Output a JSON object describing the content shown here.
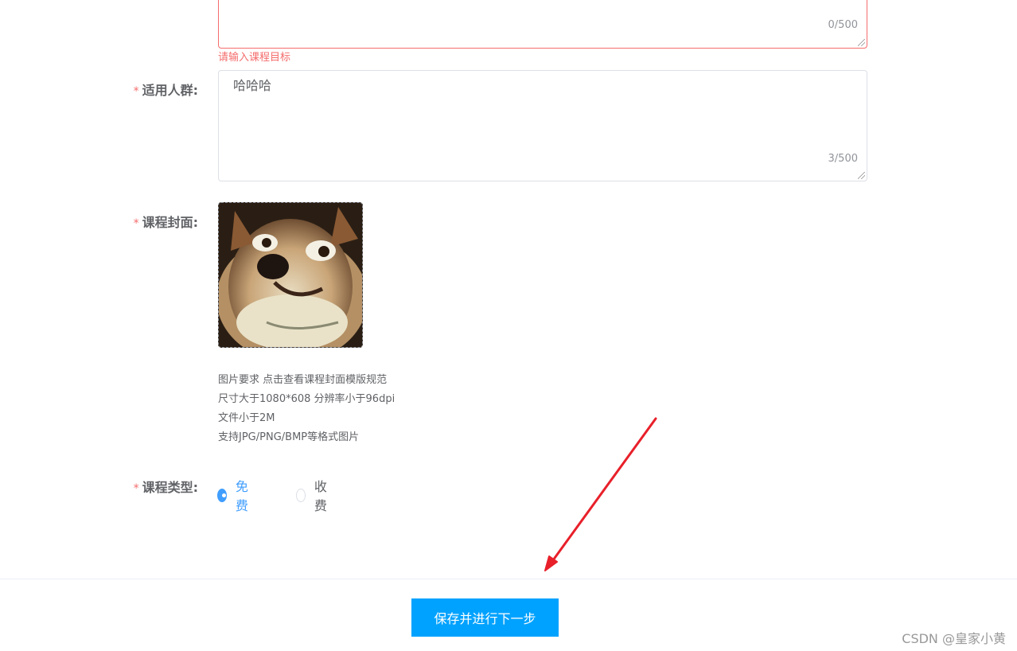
{
  "form": {
    "course_goal": {
      "value": "",
      "counter": "0/500",
      "error": "请输入课程目标"
    },
    "audience": {
      "label": "适用人群:",
      "value": "哈哈哈",
      "counter": "3/500"
    },
    "cover": {
      "label": "课程封面:",
      "hint_lines": [
        "图片要求 点击查看课程封面模版规范",
        "尺寸大于1080*608 分辨率小于96dpi",
        "文件小于2M",
        "支持JPG/PNG/BMP等格式图片"
      ]
    },
    "course_type": {
      "label": "课程类型:",
      "options": [
        {
          "label": "免费",
          "selected": true
        },
        {
          "label": "收费",
          "selected": false
        }
      ]
    },
    "required_mark": "*"
  },
  "footer": {
    "submit_label": "保存并进行下一步"
  },
  "watermark": "CSDN @皇家小黄",
  "colors": {
    "primary": "#409eff",
    "button": "#00a2ff",
    "error": "#f56c6c",
    "annotation_arrow": "#e8202a"
  }
}
